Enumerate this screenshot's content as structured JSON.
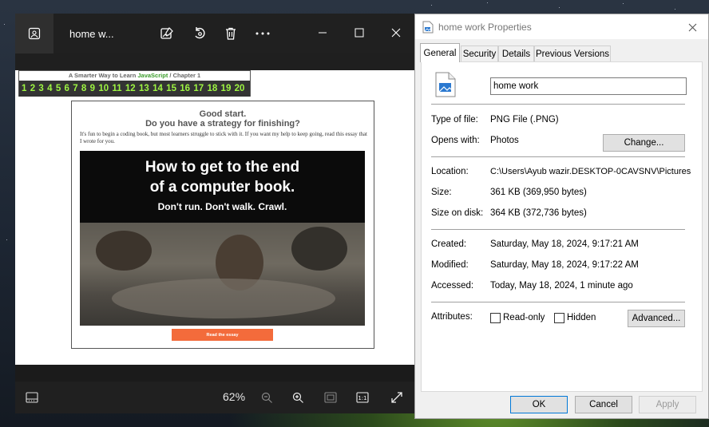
{
  "photos": {
    "title": "home w...",
    "zoom": "62%",
    "image": {
      "book_header": "A Smarter Way to Learn",
      "book_header_js": "JavaScript",
      "book_header_tail": " /  Chapter 1",
      "chapters": [
        "1",
        "2",
        "3",
        "4",
        "5",
        "6",
        "7",
        "8",
        "9",
        "10",
        "11",
        "12",
        "13",
        "14",
        "15",
        "16",
        "17",
        "18",
        "19",
        "20"
      ],
      "heading1": "Good start.",
      "heading2": "Do you have a strategy for finishing?",
      "paragraph": "It's fun to begin a coding book, but most learners struggle to stick with it. If you want my help to keep going, read this essay that I wrote for you.",
      "poster_line1": "How to get to the end",
      "poster_line2": "of a computer book.",
      "poster_line3": "Don't run. Don't walk. Crawl.",
      "button": "Read the essay"
    }
  },
  "properties": {
    "title": "home work Properties",
    "tabs": [
      "General",
      "Security",
      "Details",
      "Previous Versions"
    ],
    "file_name": "home work",
    "type_label": "Type of file:",
    "type_value": "PNG File (.PNG)",
    "opens_label": "Opens with:",
    "opens_value": "Photos",
    "change_btn": "Change...",
    "location_label": "Location:",
    "location_value": "C:\\Users\\Ayub wazir.DESKTOP-0CAVSNV\\Pictures",
    "size_label": "Size:",
    "size_value": "361 KB (369,950 bytes)",
    "size_disk_label": "Size on disk:",
    "size_disk_value": "364 KB (372,736 bytes)",
    "created_label": "Created:",
    "created_value": "Saturday, May 18, 2024, 9:17:21 AM",
    "modified_label": "Modified:",
    "modified_value": "Saturday, May 18, 2024, 9:17:22 AM",
    "accessed_label": "Accessed:",
    "accessed_value": "Today, May 18, 2024, 1 minute ago",
    "attributes_label": "Attributes:",
    "readonly_label": "Read-only",
    "hidden_label": "Hidden",
    "advanced_btn": "Advanced...",
    "ok_btn": "OK",
    "cancel_btn": "Cancel",
    "apply_btn": "Apply"
  },
  "colors": {
    "chapter_numbers": "#9ef542",
    "essay_button": "#f36b3b",
    "accent": "#0078d7"
  }
}
